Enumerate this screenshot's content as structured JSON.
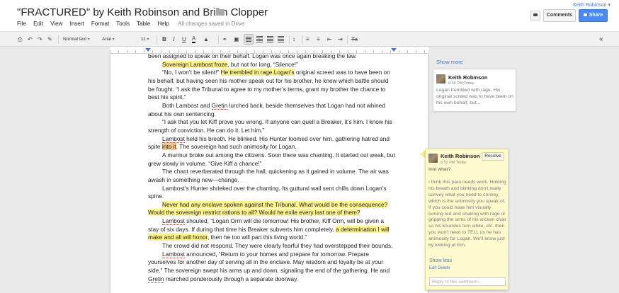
{
  "header": {
    "title": "\"FRACTURED\" by Keith Robinson and Brian Clopper",
    "menus": [
      "File",
      "Edit",
      "View",
      "Insert",
      "Format",
      "Tools",
      "Table",
      "Help"
    ],
    "save_status": "All changes saved in Drive",
    "user": "Keith Robinson ▾",
    "comments_label": "Comments",
    "share_label": "Share"
  },
  "toolbar": {
    "style": "Normal text",
    "font": "Arial",
    "size": "11",
    "bold": "B",
    "italic": "I",
    "underline": "U",
    "text_color": "A",
    "clear_format": "Tx",
    "collapse": "«"
  },
  "document": {
    "paragraphs": [
      {
        "noindent": true,
        "segments": [
          {
            "t": "been assigned to speak on their behalf. Logan was once again breaking the law."
          }
        ]
      },
      {
        "segments": [
          {
            "t": "Sovereign Lambost froze",
            "h": "y"
          },
          {
            "t": ", but not for long. “Silence!”"
          }
        ]
      },
      {
        "segments": [
          {
            "t": "“No, I won’t be silent!” "
          },
          {
            "t": "He trembled in rage.",
            "h": "y"
          },
          {
            "t": "Logan’s",
            "h": "y"
          },
          {
            "t": " original screed was to have been on his behalf, but having seen his mother speak out for his brother, he knew which battle should be fought. “I ask the Tribunal to agree to my mother’s terms, grant my brother the chance to best his spirit.”"
          }
        ]
      },
      {
        "segments": [
          {
            "t": "Both Lambost and "
          },
          {
            "t": "Gretin",
            "s": true
          },
          {
            "t": " lurched back, beside themselves that Logan had not whined about his own sentencing."
          }
        ]
      },
      {
        "segments": [
          {
            "t": "“I ask that you let Kiff prove you wrong. If anyone can quell a Breaker, it’s him. I know his strength of conviction. He can do it. Let him.”"
          }
        ]
      },
      {
        "segments": [
          {
            "t": "Lambost",
            "s": true
          },
          {
            "t": " held his breath. He blinked. His Hunter loomed over him, gathering hatred and spite "
          },
          {
            "t": "into it",
            "h": "o"
          },
          {
            "t": ". The sovereign had such animosity for Logan."
          }
        ]
      },
      {
        "segments": [
          {
            "t": "A murmur broke out among the citizens. Soon there was chanting. It started out weak, but grew slowly in volume. “Give Kiff a chance!”"
          }
        ]
      },
      {
        "segments": [
          {
            "t": "The chant reverberated through the hall, quickening as it gained in volume. The air was awash in something new—change."
          }
        ]
      },
      {
        "segments": [
          {
            "t": "Lambost’s Hunter shrieked over the chanting. Its guttural wail sent chills down Logan’s spine."
          }
        ]
      },
      {
        "segments": [
          {
            "t": "Never had any enclave spoken against the Tribunal. What would be the consequence? Would the sovereign restrict rations to all? Would he exile every last one of them?",
            "h": "y"
          }
        ]
      },
      {
        "segments": [
          {
            "t": "Lambost",
            "s": true
          },
          {
            "t": " shouted, “Logan Orm will die tomorrow! His brother, Kiff Orm, will be given a stay of six days. If during that time his Breaker subverts him completely, "
          },
          {
            "t": "a determination I will make and all will honor",
            "h": "y"
          },
          {
            "t": ", then he too will part this living world.”"
          }
        ]
      },
      {
        "segments": [
          {
            "t": "The crowd did not respond. They were clearly fearful they had overstepped their bounds."
          }
        ]
      },
      {
        "segments": [
          {
            "t": "Lambost",
            "s": true
          },
          {
            "t": " announced, “Return to your homes and prepare for tomorrow. Prepare yourselves for another day of serving all in the enclave. May wisdom and loyalty be at your side.” The sovereign swept his arms up and down, signaling the end of the gathering. He and "
          },
          {
            "t": "Gretin",
            "s": true
          },
          {
            "t": " marched ponderously through a separate doorway."
          }
        ]
      }
    ]
  },
  "comments": {
    "show_more": "Show more",
    "items": [
      {
        "author": "Keith Robinson",
        "time": "6:50 PM Today",
        "text": "Logan trembled with rage. His original screed was to have been on his own behalf, but..."
      },
      {
        "author": "Keith Robinson",
        "time": "6:52 PM Today",
        "resolve": "Resolve",
        "question": "Into what?",
        "text": "I think this para needs work. Holding his breath and blinking don't really convey what you need to convey, which is the animosity you speak of. If you could have him visually turning red and shaking with rage or gripping the arms of his wicken chair so his knuckles turn white, etc, then you won't need to TELL us he has animosity for Logan. We'll know just by looking at him.",
        "show_less": "Show less",
        "edit": "Edit",
        "delete": "Delete",
        "reply_placeholder": "Reply to this comment..."
      }
    ]
  }
}
